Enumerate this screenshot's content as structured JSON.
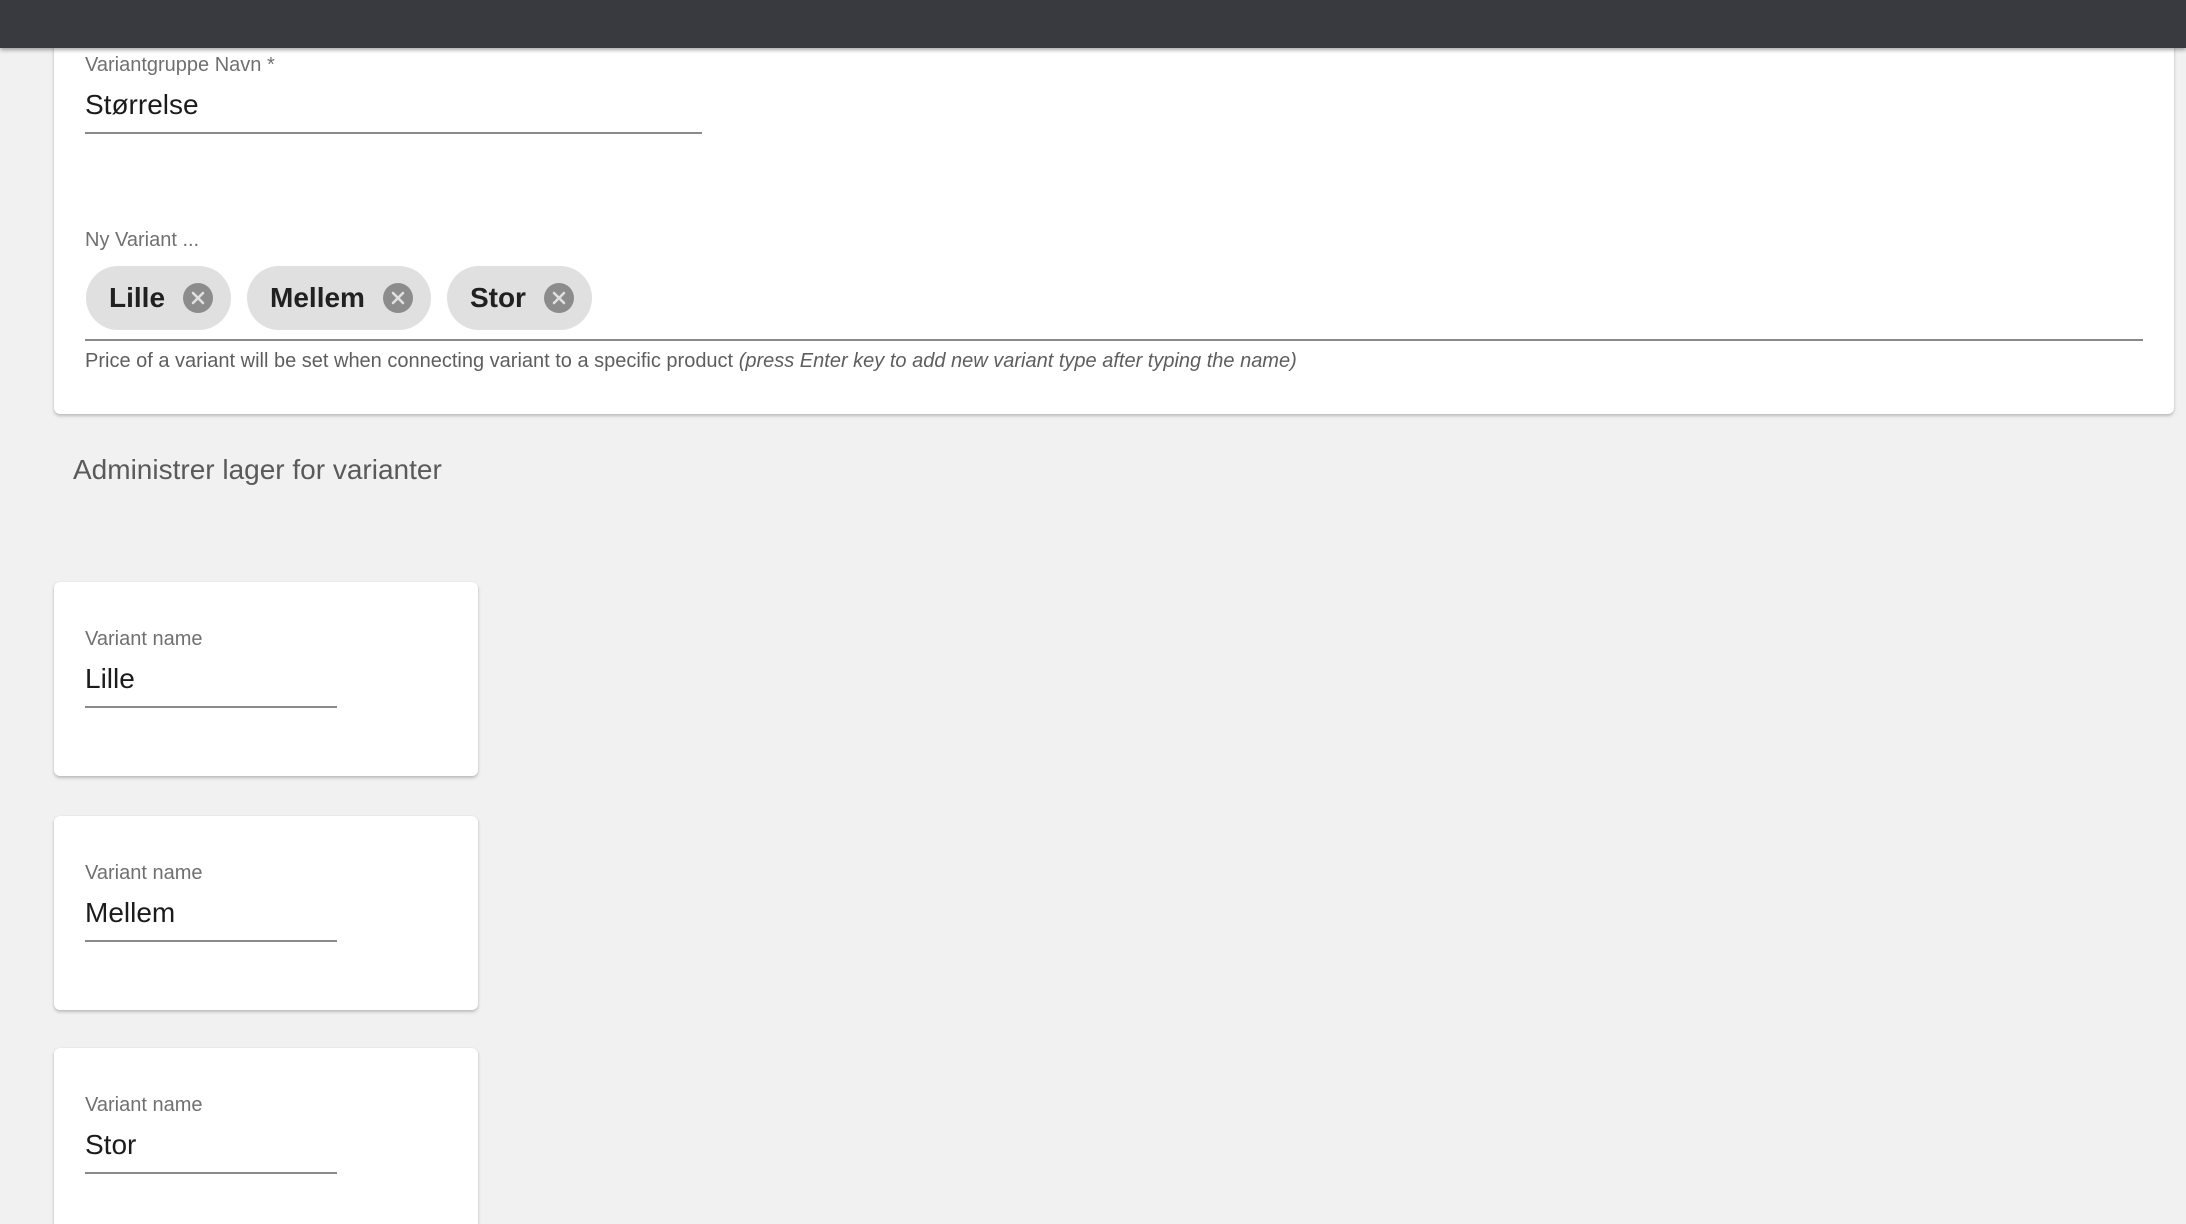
{
  "variant_group": {
    "name_label": "Variantgruppe Navn *",
    "name_value": "Størrelse",
    "new_variant_label": "Ny Variant ...",
    "chips": [
      "Lille",
      "Mellem",
      "Stor"
    ],
    "hint_text": "Price of a variant will be set when connecting variant to a specific product",
    "hint_italic": "(press Enter key to add new variant type after typing the name)"
  },
  "inventory": {
    "title": "Administrer lager for varianter",
    "variants": [
      {
        "label": "Variant name",
        "value": "Lille"
      },
      {
        "label": "Variant name",
        "value": "Mellem"
      },
      {
        "label": "Variant name",
        "value": "Stor"
      }
    ]
  },
  "colors": {
    "topbar": "#383a3f",
    "chip_bg": "#e0e0e0",
    "chip_remove": "#8c8c8c",
    "page_bg": "#f1f1f1"
  },
  "icons": {
    "chip_remove": "close-circle-icon"
  }
}
